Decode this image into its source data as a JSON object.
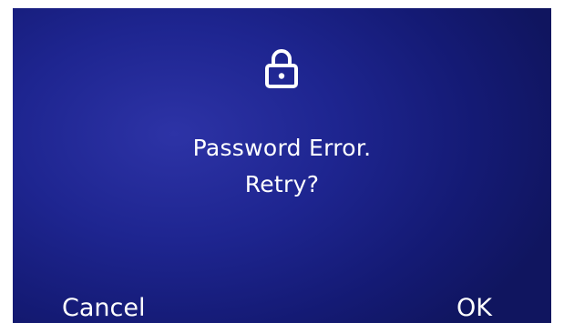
{
  "dialog": {
    "icon": "lock-icon",
    "message_line1": "Password Error.",
    "message_line2": "Retry?"
  },
  "softkeys": {
    "cancel_label": "Cancel",
    "ok_label": "OK"
  },
  "colors": {
    "background_center": "#2d33a6",
    "background_edge": "#10155f",
    "text": "#ffffff",
    "frame": "#ffffff"
  }
}
